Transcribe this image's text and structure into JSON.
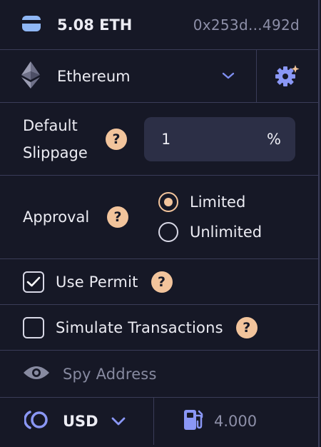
{
  "wallet": {
    "balance": "5.08 ETH",
    "address": "0x253d...492d",
    "icon": "wallet-icon"
  },
  "network": {
    "name": "Ethereum",
    "icon": "ethereum-icon",
    "settings_icon": "settings-sparkle-icon"
  },
  "slippage": {
    "label_line1": "Default",
    "label_line2": "Slippage",
    "value": "1",
    "unit": "%"
  },
  "approval": {
    "label": "Approval",
    "options": [
      {
        "label": "Limited",
        "selected": true
      },
      {
        "label": "Unlimited",
        "selected": false
      }
    ]
  },
  "permit": {
    "label": "Use Permit",
    "checked": true
  },
  "simulate": {
    "label": "Simulate Transactions",
    "checked": false
  },
  "spy": {
    "label": "Spy Address"
  },
  "footer": {
    "currency": "USD",
    "gas_value": "4.000"
  },
  "help_glyph": "?",
  "colors": {
    "background": "#161826",
    "border": "#3a3c58",
    "accent": "#f2c49c",
    "field": "#2c2f46",
    "muted": "#878aa0",
    "link": "#7f8ef0"
  }
}
